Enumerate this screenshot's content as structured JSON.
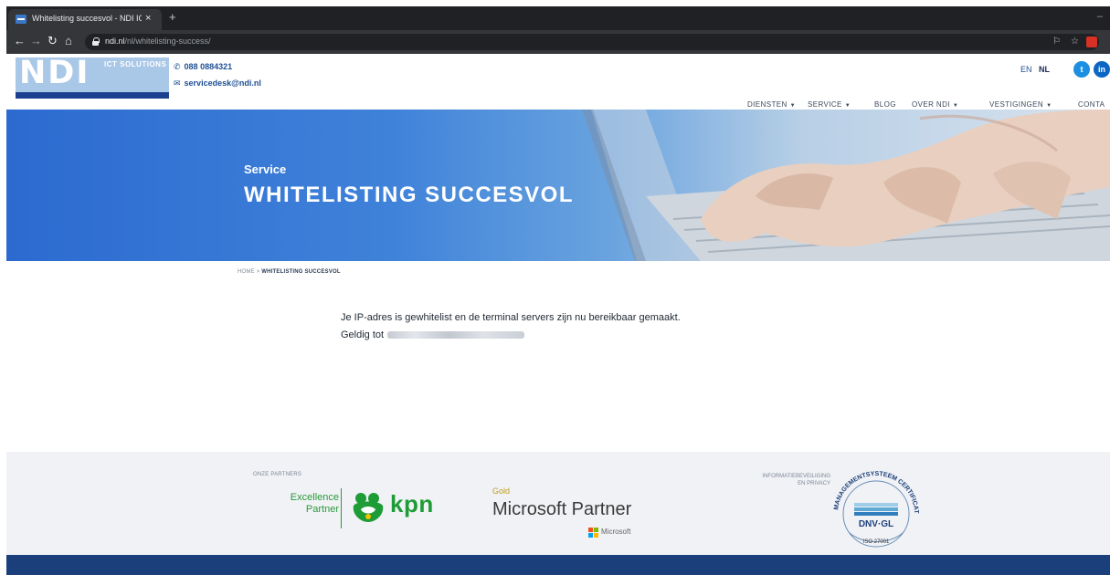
{
  "browser": {
    "tab_title": "Whitelisting succesvol - NDI ICT",
    "tab_close": "×",
    "new_tab": "+",
    "url_domain": "ndi.nl",
    "url_path": "/nl/whitelisting-success/"
  },
  "header": {
    "logo_text": "NDI",
    "logo_tagline": "ICT SOLUTIONS",
    "phone": "088 0884321",
    "email": "servicedesk@ndi.nl",
    "languages": [
      "EN",
      "NL"
    ],
    "active_language": "NL",
    "nav": [
      "DIENSTEN",
      "SERVICE",
      "BLOG",
      "OVER NDI",
      "VESTIGINGEN",
      "CONTA"
    ]
  },
  "hero": {
    "subtitle": "Service",
    "title": "WHITELISTING SUCCESVOL"
  },
  "breadcrumb": {
    "home": "HOME",
    "separator": ">",
    "current": "WHITELISTING SUCCESVOL"
  },
  "content": {
    "message": "Je IP-adres is gewhitelist en de terminal servers zijn nu bereikbaar gemaakt.",
    "valid_prefix": "Geldig tot"
  },
  "footer": {
    "partners_label": "ONZE PARTNERS",
    "kpn_badge_line1": "Excellence",
    "kpn_badge_line2": "Partner",
    "kpn_text": "kpn",
    "ms_tier": "Gold",
    "ms_partner": "Microsoft Partner",
    "ms_small": "Microsoft",
    "infosec_label_1": "INFORMATIEBEVEILIGING",
    "infosec_label_2": "EN PRIVACY",
    "cert_arc_text": "MANAGEMENTSYSTEEM CERTIFICATE",
    "cert_name": "DNV·GL",
    "cert_standard": "ISO 27001"
  },
  "colors": {
    "brand_blue": "#1d4f93",
    "kpn_green": "#1e9c36",
    "footer_navy": "#1b3f7a"
  }
}
